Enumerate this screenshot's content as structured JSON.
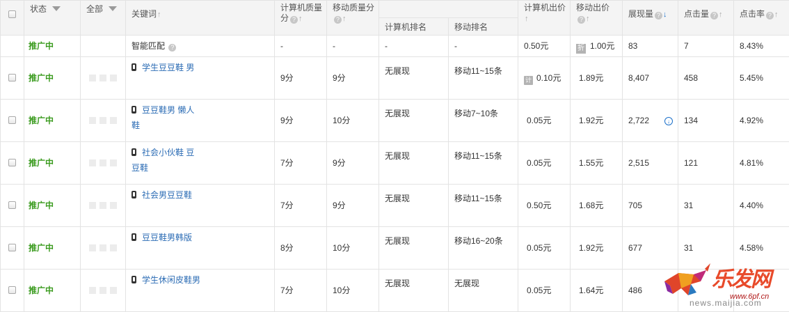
{
  "header": {
    "status": "状态",
    "filter_all": "全部",
    "keyword": "关键词",
    "pc_quality_line1": "计算机质量",
    "pc_quality_line2": "分",
    "mobile_quality": "移动质量分",
    "ranking_pc": "计算机排名",
    "ranking_mobile": "移动排名",
    "pc_bid": "计算机出价",
    "mobile_bid": "移动出价",
    "impressions": "展现量",
    "clicks": "点击量",
    "ctr": "点击率",
    "help_glyph": "?",
    "sort_glyph": "↑",
    "sort_active_glyph": "↓"
  },
  "smart_row": {
    "status": "推广中",
    "keyword": "智能匹配",
    "pc_quality": "-",
    "mobile_quality": "-",
    "ranking_pc": "-",
    "ranking_mobile": "-",
    "pc_bid": "0.50元",
    "discount_label": "折",
    "mobile_bid": "1.00元",
    "impressions": "83",
    "clicks": "7",
    "ctr": "8.43%"
  },
  "rows": [
    {
      "status": "推广中",
      "keyword_line1": "学生豆豆鞋 男",
      "keyword_line2": "",
      "pc_quality": "9分",
      "mobile_quality": "9分",
      "ranking_pc": "无展现",
      "ranking_mobile": "移动11~15条",
      "pc_bid_label": "计",
      "pc_bid": "0.10元",
      "mobile_bid": "1.89元",
      "impressions": "8,407",
      "clicks": "458",
      "ctr": "5.45%"
    },
    {
      "status": "推广中",
      "keyword_line1": "豆豆鞋男 懒人",
      "keyword_line2": "鞋",
      "pc_quality": "9分",
      "mobile_quality": "10分",
      "ranking_pc": "无展现",
      "ranking_mobile": "移动7~10条",
      "pc_bid": "0.05元",
      "mobile_bid": "1.92元",
      "impressions": "2,722",
      "clicks": "134",
      "ctr": "4.92%"
    },
    {
      "status": "推广中",
      "keyword_line1": "社会小伙鞋 豆",
      "keyword_line2": "豆鞋",
      "pc_quality": "7分",
      "mobile_quality": "9分",
      "ranking_pc": "无展现",
      "ranking_mobile": "移动11~15条",
      "pc_bid": "0.05元",
      "mobile_bid": "1.55元",
      "impressions": "2,515",
      "clicks": "121",
      "ctr": "4.81%"
    },
    {
      "status": "推广中",
      "keyword_line1": "社会男豆豆鞋",
      "keyword_line2": "",
      "pc_quality": "7分",
      "mobile_quality": "9分",
      "ranking_pc": "无展现",
      "ranking_mobile": "移动11~15条",
      "pc_bid": "0.50元",
      "mobile_bid": "1.68元",
      "impressions": "705",
      "clicks": "31",
      "ctr": "4.40%"
    },
    {
      "status": "推广中",
      "keyword_line1": "豆豆鞋男韩版",
      "keyword_line2": "",
      "pc_quality": "8分",
      "mobile_quality": "10分",
      "ranking_pc": "无展现",
      "ranking_mobile": "移动16~20条",
      "pc_bid": "0.05元",
      "mobile_bid": "1.92元",
      "impressions": "677",
      "clicks": "31",
      "ctr": "4.58%"
    },
    {
      "status": "推广中",
      "keyword_line1": "学生休闲皮鞋男",
      "keyword_line2": "",
      "pc_quality": "7分",
      "mobile_quality": "10分",
      "ranking_pc": "无展现",
      "ranking_mobile": "无展现",
      "pc_bid": "0.05元",
      "mobile_bid": "1.64元",
      "impressions": "486",
      "clicks": "",
      "ctr": ""
    }
  ],
  "watermark": {
    "brand": "乐发网",
    "url": "www.6pf.cn",
    "news": "news.maijia.com"
  }
}
